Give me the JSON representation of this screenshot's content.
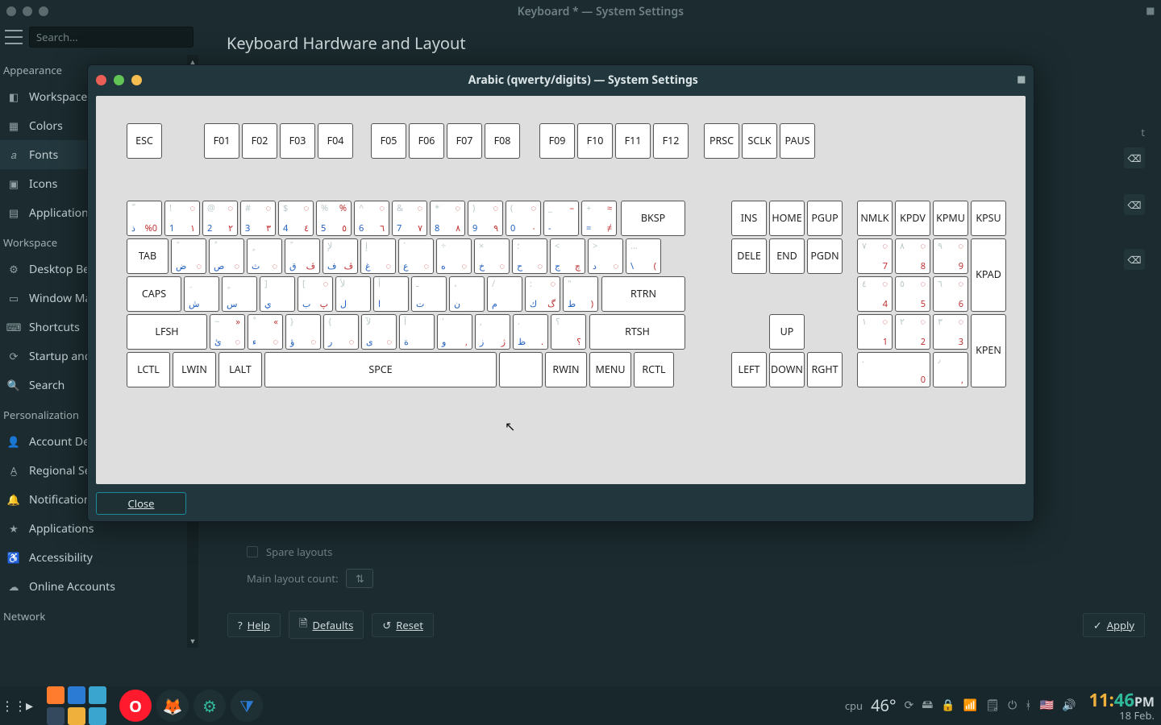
{
  "main_window": {
    "title": "Keyboard * — System Settings"
  },
  "toolbar": {
    "search_placeholder": "Search..."
  },
  "header": "Keyboard Hardware and Layout",
  "sidebar": {
    "sec_appearance": "Appearance",
    "sec_workspace": "Workspace",
    "sec_personalization": "Personalization",
    "sec_network": "Network",
    "items": {
      "workspace_theme": "Workspace T",
      "colors": "Colors",
      "fonts": "Fonts",
      "icons": "Icons",
      "app_style": "Application",
      "desktop_behavior": "Desktop Beh",
      "window_mgmt": "Window Ma",
      "shortcuts": "Shortcuts",
      "startup": "Startup and",
      "search": "Search",
      "account": "Account Det",
      "regional": "Regional Set",
      "notifications": "Notification",
      "applications": "Applications",
      "accessibility": "Accessibility",
      "online_accounts": "Online Accounts"
    }
  },
  "content": {
    "spare_layouts": "Spare layouts",
    "main_layout_count": "Main layout count:"
  },
  "footer": {
    "help": "Help",
    "defaults": "Defaults",
    "reset": "Reset",
    "apply": "Apply"
  },
  "dialog": {
    "title": "Arabic (qwerty/digits) — System Settings",
    "close": "Close"
  },
  "kb": {
    "esc": "ESC",
    "f": [
      "F01",
      "F02",
      "F03",
      "F04",
      "F05",
      "F06",
      "F07",
      "F08",
      "F09",
      "F10",
      "F11",
      "F12"
    ],
    "prsc": "PRSC",
    "sclk": "SCLK",
    "paus": "PAUS",
    "bksp": "BKSP",
    "tab": "TAB",
    "caps": "CAPS",
    "lfsh": "LFSH",
    "rtsh": "RTSH",
    "rtrn": "RTRN",
    "lctl": "LCTL",
    "lwin": "LWIN",
    "lalt": "LALT",
    "spce": "SPCE",
    "rwin": "RWIN",
    "menu": "MENU",
    "rctl": "RCTL",
    "ins": "INS",
    "home": "HOME",
    "pgup": "PGUP",
    "dele": "DELE",
    "end": "END",
    "pgdn": "PGDN",
    "up": "UP",
    "left": "LEFT",
    "down": "DOWN",
    "rght": "RGHT",
    "nmlk": "NMLK",
    "kpdv": "KPDV",
    "kpmu": "KPMU",
    "kpsu": "KPSU",
    "kpad": "KPAD",
    "kpen": "KPEN",
    "row1": [
      {
        "tl": "ّ",
        "tr": "",
        "bl": "ذ",
        "br": "%0"
      },
      {
        "tl": "!",
        "tr": "◌",
        "bl": "1",
        "br": "١"
      },
      {
        "tl": "@",
        "tr": "◌",
        "bl": "2",
        "br": "٢"
      },
      {
        "tl": "#",
        "tr": "◌",
        "bl": "3",
        "br": "٣"
      },
      {
        "tl": "$",
        "tr": "◌",
        "bl": "4",
        "br": "٤"
      },
      {
        "tl": "%",
        "tr": "%",
        "bl": "5",
        "br": "٥"
      },
      {
        "tl": "^",
        "tr": "◌",
        "bl": "6",
        "br": "٦"
      },
      {
        "tl": "&",
        "tr": "◌",
        "bl": "7",
        "br": "٧"
      },
      {
        "tl": "*",
        "tr": "◌",
        "bl": "8",
        "br": "٨"
      },
      {
        "tl": ")",
        "tr": "◌",
        "bl": "9",
        "br": "٩"
      },
      {
        "tl": "(",
        "tr": "◌",
        "bl": "0",
        "br": "٠"
      },
      {
        "tl": "_",
        "tr": "–",
        "bl": "-",
        "br": ""
      },
      {
        "tl": "+",
        "tr": "≈",
        "bl": "=",
        "br": "≠"
      }
    ],
    "row2": [
      {
        "tl": "ً",
        "tr": "",
        "bl": "ض",
        "br": "◌"
      },
      {
        "tl": "ٌ",
        "tr": "",
        "bl": "ص",
        "br": "◌"
      },
      {
        "tl": "ٍ",
        "tr": "",
        "bl": "ث",
        "br": "◌"
      },
      {
        "tl": "ً",
        "tr": "",
        "bl": "ق",
        "br": "ڤ"
      },
      {
        "tl": "لإ",
        "tr": "",
        "bl": "ف",
        "br": "ڤ"
      },
      {
        "tl": "إ",
        "tr": "",
        "bl": "غ",
        "br": "◌"
      },
      {
        "tl": "`",
        "tr": "",
        "bl": "ع",
        "br": "◌"
      },
      {
        "tl": "÷",
        "tr": "",
        "bl": "ه",
        "br": "◌"
      },
      {
        "tl": "×",
        "tr": "",
        "bl": "خ",
        "br": "◌"
      },
      {
        "tl": "؛",
        "tr": "",
        "bl": "ح",
        "br": "◌"
      },
      {
        "tl": "<",
        "tr": "",
        "bl": "ج",
        "br": "چ"
      },
      {
        "tl": ">",
        "tr": "",
        "bl": "د",
        "br": "◌"
      },
      {
        "tl": "…",
        "tr": "",
        "bl": "\\",
        "br": "("
      }
    ],
    "row3": [
      {
        "tl": "ِ",
        "tr": "",
        "bl": "ش",
        "br": ""
      },
      {
        "tl": "ٍ",
        "tr": "",
        "bl": "س",
        "br": ""
      },
      {
        "tl": "]",
        "tr": "",
        "bl": "ي",
        "br": ""
      },
      {
        "tl": "[",
        "tr": "◌",
        "bl": "ب",
        "br": "پ"
      },
      {
        "tl": "لأ",
        "tr": "",
        "bl": "ل",
        "br": ""
      },
      {
        "tl": "أ",
        "tr": "",
        "bl": "ا",
        "br": ""
      },
      {
        "tl": "ـ",
        "tr": "",
        "bl": "ت",
        "br": ""
      },
      {
        "tl": "،",
        "tr": "",
        "bl": "ن",
        "br": ""
      },
      {
        "tl": "/",
        "tr": "",
        "bl": "م",
        "br": ""
      },
      {
        "tl": ":",
        "tr": "◌",
        "bl": "ك",
        "br": "گ"
      },
      {
        "tl": "\"",
        "tr": "",
        "bl": "ط",
        "br": ")"
      }
    ],
    "row4": [
      {
        "tl": "~",
        "tr": "»",
        "bl": "ئ",
        "br": "◌"
      },
      {
        "tl": "ْ",
        "tr": "«",
        "bl": "ء",
        "br": "◌"
      },
      {
        "tl": "}",
        "tr": "",
        "bl": "ؤ",
        "br": "◌"
      },
      {
        "tl": "{",
        "tr": "",
        "bl": "ر",
        "br": "◌"
      },
      {
        "tl": "لآ",
        "tr": "",
        "bl": "ى",
        "br": "◌"
      },
      {
        "tl": "آ",
        "tr": "",
        "bl": "ة",
        "br": ""
      },
      {
        "tl": "'",
        "tr": "",
        "bl": "و",
        "br": ","
      },
      {
        "tl": ",",
        "tr": "",
        "bl": "ز",
        "br": "ژ"
      },
      {
        "tl": ".",
        "tr": "",
        "bl": "ظ",
        "br": "."
      },
      {
        "tl": "؟",
        "tr": "",
        "bl": "",
        "br": "؟"
      }
    ],
    "np": [
      {
        "tl": "٧",
        "tr": "◌",
        "bl": "",
        "br": "7"
      },
      {
        "tl": "٨",
        "tr": "◌",
        "bl": "",
        "br": "8"
      },
      {
        "tl": "٩",
        "tr": "◌",
        "bl": "",
        "br": "9"
      },
      {
        "tl": "٤",
        "tr": "◌",
        "bl": "",
        "br": "4"
      },
      {
        "tl": "٥",
        "tr": "◌",
        "bl": "",
        "br": "5"
      },
      {
        "tl": "٦",
        "tr": "◌",
        "bl": "",
        "br": "6"
      },
      {
        "tl": "١",
        "tr": "◌",
        "bl": "",
        "br": "1"
      },
      {
        "tl": "٢",
        "tr": "◌",
        "bl": "",
        "br": "2"
      },
      {
        "tl": "٣",
        "tr": "◌",
        "bl": "",
        "br": "3"
      },
      {
        "tl": ".",
        "tr": "",
        "bl": "",
        "br": "0"
      },
      {
        "tl": "٫",
        "tr": "",
        "bl": "",
        "br": ","
      }
    ]
  },
  "tray": {
    "cpu": "cpu",
    "temp": "46°",
    "time_h": "11:",
    "time_m": "46",
    "time_p": "PM",
    "date": "18 Feb."
  }
}
